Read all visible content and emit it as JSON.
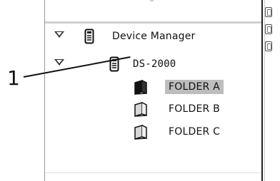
{
  "callout": {
    "number": "1"
  },
  "tree": {
    "root": {
      "label": "Device Manager",
      "icon": "device-icon",
      "expanded": true
    },
    "device": {
      "label": "DS-2000",
      "icon": "device-icon",
      "expanded": true
    },
    "folders": [
      {
        "label": "FOLDER A",
        "icon": "folder-icon",
        "selected": true
      },
      {
        "label": "FOLDER B",
        "icon": "folder-icon",
        "selected": false
      },
      {
        "label": "FOLDER C",
        "icon": "folder-icon",
        "selected": false
      }
    ]
  },
  "colors": {
    "selection": "#bdbdbd",
    "border": "#222222"
  }
}
